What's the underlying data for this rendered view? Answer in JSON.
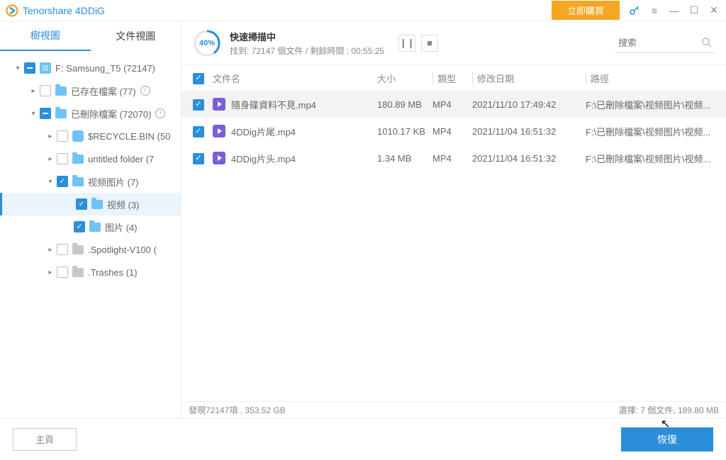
{
  "titlebar": {
    "app_name": "Tenorshare 4DDiG",
    "buy_label": "立即購買"
  },
  "tabs": {
    "tree": "樹視圖",
    "file": "文件視圖"
  },
  "tree": {
    "drive": "F: Samsung_T5 (72147)",
    "existing": "已存在檔案 (77)",
    "deleted": "已刪除檔案 (72070)",
    "recycle": "$RECYCLE.BIN (50",
    "untitled": "untitled folder (7",
    "video_pic": "视频图片 (7)",
    "video": "视频 (3)",
    "pic": "图片 (4)",
    "spotlight": ".Spotlight-V100 (",
    "trashes": ".Trashes (1)"
  },
  "scan": {
    "percent": "40%",
    "title": "快速掃描中",
    "subtitle": "找到: 72147 個文件 / 剩餘時間 : 00:55:25"
  },
  "search": {
    "placeholder": "搜索"
  },
  "columns": {
    "name": "文件名",
    "size": "大小",
    "type": "類型",
    "date": "修改日期",
    "path": "路徑"
  },
  "files": [
    {
      "name": "隨身碟資料不見.mp4",
      "size": "180.89 MB",
      "type": "MP4",
      "date": "2021/11/10 17:49:42",
      "path": "F:\\已刪除檔案\\视频图片\\视频..."
    },
    {
      "name": "4DDig片尾.mp4",
      "size": "1010.17 KB",
      "type": "MP4",
      "date": "2021/11/04 16:51:32",
      "path": "F:\\已刪除檔案\\视频图片\\视频..."
    },
    {
      "name": "4DDig片头.mp4",
      "size": "1.34 MB",
      "type": "MP4",
      "date": "2021/11/04 16:51:32",
      "path": "F:\\已刪除檔案\\视频图片\\视频..."
    }
  ],
  "status": {
    "left": "發現72147項 , 353.52 GB",
    "right": "選擇: 7 個文件, 189.80 MB"
  },
  "footer": {
    "home": "主頁",
    "recover": "恢復"
  }
}
